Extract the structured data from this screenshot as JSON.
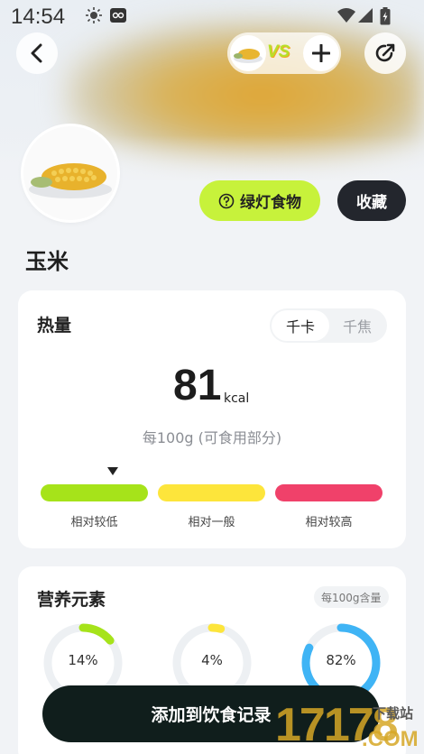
{
  "status_bar": {
    "time": "14:54"
  },
  "header": {
    "back_icon": "chevron-left-icon",
    "compare_icon": "vs-icon",
    "add_icon": "plus-icon",
    "share_icon": "share-icon",
    "vs_text": "VS"
  },
  "actions": {
    "traffic_light_label": "绿灯食物",
    "favorite_label": "收藏"
  },
  "food": {
    "name": "玉米"
  },
  "calories": {
    "title": "热量",
    "unit_options": [
      "千卡",
      "千焦"
    ],
    "selected_unit": "千卡",
    "value": "81",
    "unit": "kcal",
    "per_note": "每100g (可食用部分)",
    "levels": [
      {
        "label": "相对较低",
        "color": "#a6e31a"
      },
      {
        "label": "相对一般",
        "color": "#fde53b"
      },
      {
        "label": "相对较高",
        "color": "#f0416a"
      }
    ],
    "current_level_index": 0
  },
  "nutrients": {
    "title": "营养元素",
    "badge": "每100g含量",
    "rings": [
      {
        "percent": "14%",
        "value": 14,
        "color": "#a6e31a"
      },
      {
        "percent": "4%",
        "value": 4,
        "color": "#fde53b"
      },
      {
        "percent": "82%",
        "value": 82,
        "color": "#3fb4f5"
      }
    ]
  },
  "bottom": {
    "add_label": "添加到饮食记录"
  },
  "watermark": {
    "big": "17178",
    "small": "下载站",
    "com": ".COM"
  }
}
